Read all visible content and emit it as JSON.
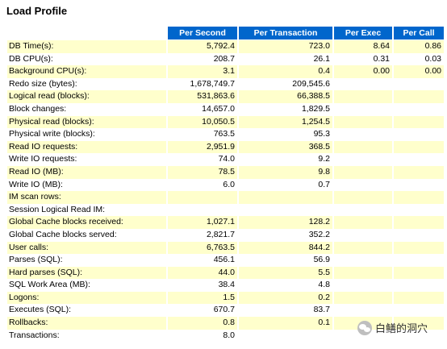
{
  "title": "Load Profile",
  "headers": [
    "Per Second",
    "Per Transaction",
    "Per Exec",
    "Per Call"
  ],
  "rows": [
    {
      "label": "DB Time(s):",
      "per_second": "5,792.4",
      "per_transaction": "723.0",
      "per_exec": "8.64",
      "per_call": "0.86"
    },
    {
      "label": "DB CPU(s):",
      "per_second": "208.7",
      "per_transaction": "26.1",
      "per_exec": "0.31",
      "per_call": "0.03"
    },
    {
      "label": "Background CPU(s):",
      "per_second": "3.1",
      "per_transaction": "0.4",
      "per_exec": "0.00",
      "per_call": "0.00"
    },
    {
      "label": "Redo size (bytes):",
      "per_second": "1,678,749.7",
      "per_transaction": "209,545.6",
      "per_exec": "",
      "per_call": ""
    },
    {
      "label": "Logical read (blocks):",
      "per_second": "531,863.6",
      "per_transaction": "66,388.5",
      "per_exec": "",
      "per_call": ""
    },
    {
      "label": "Block changes:",
      "per_second": "14,657.0",
      "per_transaction": "1,829.5",
      "per_exec": "",
      "per_call": ""
    },
    {
      "label": "Physical read (blocks):",
      "per_second": "10,050.5",
      "per_transaction": "1,254.5",
      "per_exec": "",
      "per_call": ""
    },
    {
      "label": "Physical write (blocks):",
      "per_second": "763.5",
      "per_transaction": "95.3",
      "per_exec": "",
      "per_call": ""
    },
    {
      "label": "Read IO requests:",
      "per_second": "2,951.9",
      "per_transaction": "368.5",
      "per_exec": "",
      "per_call": ""
    },
    {
      "label": "Write IO requests:",
      "per_second": "74.0",
      "per_transaction": "9.2",
      "per_exec": "",
      "per_call": ""
    },
    {
      "label": "Read IO (MB):",
      "per_second": "78.5",
      "per_transaction": "9.8",
      "per_exec": "",
      "per_call": ""
    },
    {
      "label": "Write IO (MB):",
      "per_second": "6.0",
      "per_transaction": "0.7",
      "per_exec": "",
      "per_call": ""
    },
    {
      "label": "IM scan rows:",
      "per_second": "",
      "per_transaction": "",
      "per_exec": "",
      "per_call": ""
    },
    {
      "label": "Session Logical Read IM:",
      "per_second": "",
      "per_transaction": "",
      "per_exec": "",
      "per_call": ""
    },
    {
      "label": "Global Cache blocks received:",
      "per_second": "1,027.1",
      "per_transaction": "128.2",
      "per_exec": "",
      "per_call": ""
    },
    {
      "label": "Global Cache blocks served:",
      "per_second": "2,821.7",
      "per_transaction": "352.2",
      "per_exec": "",
      "per_call": ""
    },
    {
      "label": "User calls:",
      "per_second": "6,763.5",
      "per_transaction": "844.2",
      "per_exec": "",
      "per_call": ""
    },
    {
      "label": "Parses (SQL):",
      "per_second": "456.1",
      "per_transaction": "56.9",
      "per_exec": "",
      "per_call": ""
    },
    {
      "label": "Hard parses (SQL):",
      "per_second": "44.0",
      "per_transaction": "5.5",
      "per_exec": "",
      "per_call": ""
    },
    {
      "label": "SQL Work Area (MB):",
      "per_second": "38.4",
      "per_transaction": "4.8",
      "per_exec": "",
      "per_call": ""
    },
    {
      "label": "Logons:",
      "per_second": "1.5",
      "per_transaction": "0.2",
      "per_exec": "",
      "per_call": ""
    },
    {
      "label": "Executes (SQL):",
      "per_second": "670.7",
      "per_transaction": "83.7",
      "per_exec": "",
      "per_call": ""
    },
    {
      "label": "Rollbacks:",
      "per_second": "0.8",
      "per_transaction": "0.1",
      "per_exec": "",
      "per_call": ""
    },
    {
      "label": "Transactions:",
      "per_second": "8.0",
      "per_transaction": "",
      "per_exec": "",
      "per_call": ""
    }
  ],
  "watermark": {
    "icon": "wechat-icon",
    "text": "白鳝的洞穴"
  },
  "colors": {
    "header_bg": "#0066cc",
    "header_text": "#ffffff",
    "stripe": "#ffffcc"
  }
}
